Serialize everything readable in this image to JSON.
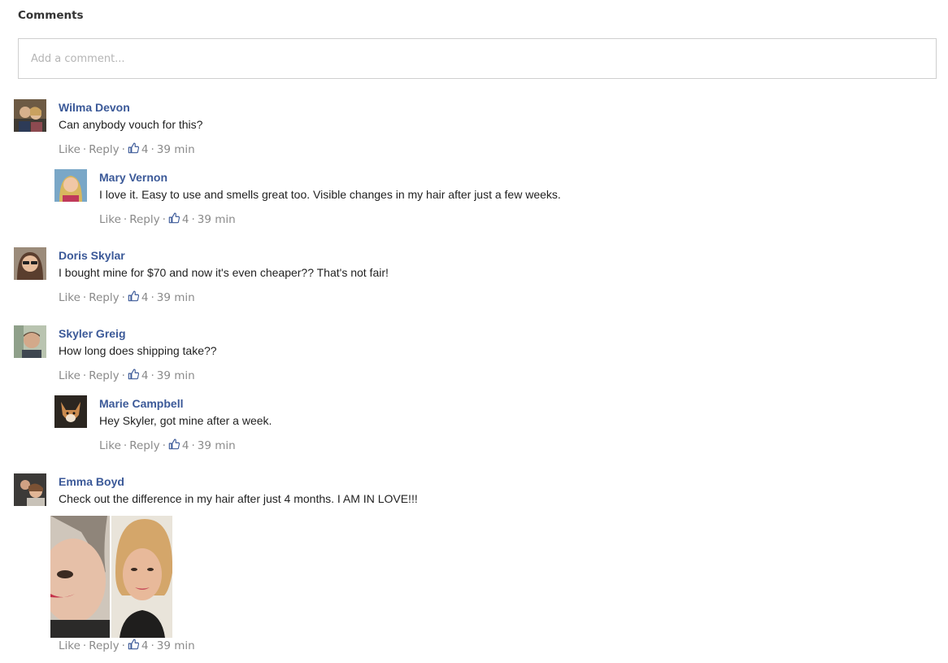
{
  "section": {
    "title": "Comments"
  },
  "composer": {
    "placeholder": "Add a comment..."
  },
  "actions": {
    "like": "Like",
    "reply": "Reply",
    "dot": "·"
  },
  "comments": [
    {
      "name": "Wilma Devon",
      "text": "Can anybody vouch for this?",
      "likes": "4",
      "time": "39 min"
    },
    {
      "name": "Mary Vernon",
      "text": "I love it. Easy to use and smells great too. Visible changes in my hair after just a few weeks.",
      "likes": "4",
      "time": "39 min"
    },
    {
      "name": "Doris Skylar",
      "text": "I bought mine for $70 and now it's even cheaper?? That's not fair!",
      "likes": "4",
      "time": "39 min"
    },
    {
      "name": "Skyler Greig",
      "text": "How long does shipping take??",
      "likes": "4",
      "time": "39 min"
    },
    {
      "name": "Marie Campbell",
      "text": "Hey Skyler, got mine after a week.",
      "likes": "4",
      "time": "39 min"
    },
    {
      "name": "Emma Boyd",
      "text": "Check out the difference in my hair after just 4 months. I AM IN LOVE!!!",
      "likes": "4",
      "time": "39 min"
    }
  ],
  "colors": {
    "name": "#3b5998",
    "muted": "#8a8a8a",
    "thumb": "#3b5998",
    "border": "#cfcfcf"
  }
}
